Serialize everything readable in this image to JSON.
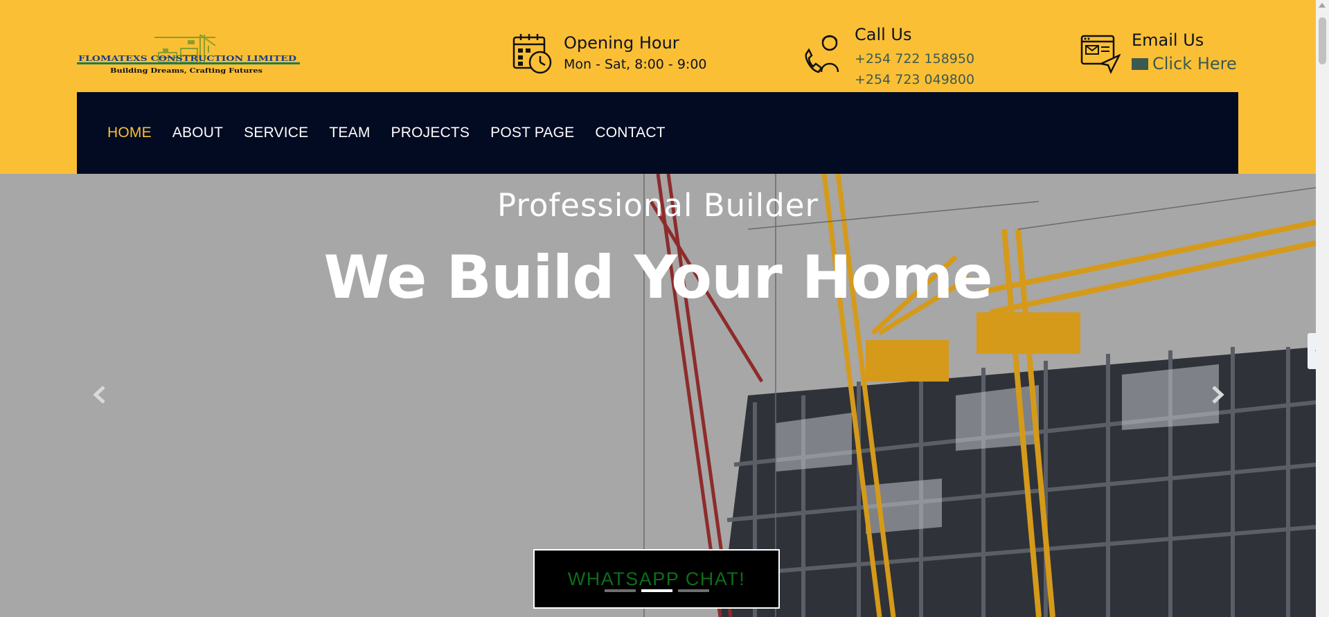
{
  "header": {
    "logo": {
      "company_name": "FLOMATEXS CONSTRUCTION LIMITED",
      "tagline": "Building Dreams, Crafting Futures"
    },
    "opening": {
      "title": "Opening Hour",
      "text": "Mon - Sat, 8:00 - 9:00",
      "icon": "calendar-clock-icon"
    },
    "call": {
      "title": "Call Us",
      "phones": [
        "+254 722 158950",
        "+254 723 049800"
      ],
      "icon": "phone-support-icon"
    },
    "email": {
      "title": "Email Us",
      "link": "Click Here",
      "icon": "email-window-icon",
      "link_icon": "envelope-icon"
    }
  },
  "nav": {
    "items": [
      "HOME",
      "ABOUT",
      "SERVICE",
      "TEAM",
      "PROJECTS",
      "POST PAGE",
      "CONTACT"
    ],
    "active": "HOME"
  },
  "hero": {
    "subtitle": "Professional Builder",
    "title": "We Build Your Home",
    "whatsapp_label": "WHATSAPP CHAT!",
    "slides_total": 3,
    "active_slide": 2
  },
  "side_tab": {
    "glyph": "❮"
  },
  "colors": {
    "brand_yellow": "#fbbf36",
    "nav_dark": "#020b22",
    "active_nav": "#fbbf36",
    "whatsapp_text": "#0e6d1a",
    "hero_overlay": "#a7a7a7"
  }
}
